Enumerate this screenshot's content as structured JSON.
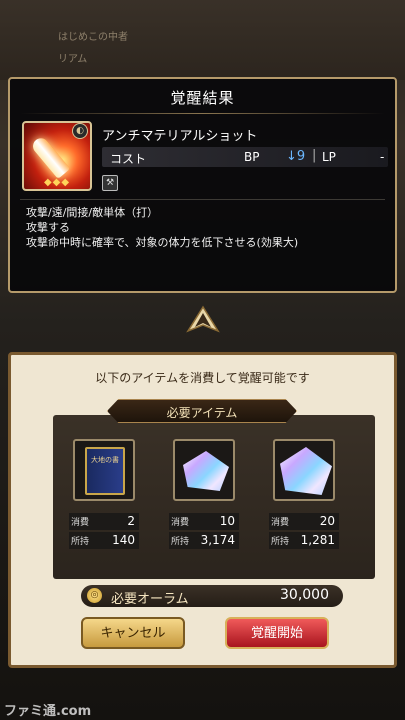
{
  "background": {
    "label1": "はじめこの中者",
    "label2": "リアム"
  },
  "result": {
    "title": "覚醒結果",
    "skill_name": "アンチマテリアルショット",
    "cost_label": "コスト",
    "bp_label": "BP",
    "bp_value": "↓9",
    "lp_label": "LP",
    "lp_value": "-",
    "stars": "◆◆◆",
    "description": [
      "攻撃/遠/間接/敵単体（打）",
      "攻撃する",
      "攻撃命中時に確率で、対象の体力を低下させる(効果大)"
    ]
  },
  "requirements": {
    "caption": "以下のアイテムを消費して覚醒可能です",
    "header": "必要アイテム",
    "consume_label": "消費",
    "owned_label": "所持",
    "items": [
      {
        "icon": "book-icon",
        "book_text": "大地の書",
        "consume": "2",
        "owned": "140"
      },
      {
        "icon": "crystal-icon",
        "consume": "10",
        "owned": "3,174"
      },
      {
        "icon": "large-crystal-icon",
        "consume": "20",
        "owned": "1,281"
      }
    ],
    "aurum_label": "必要オーラム",
    "aurum_value": "30,000",
    "cancel_label": "キャンセル",
    "start_label": "覚醒開始"
  },
  "watermark": "ファミ通.com",
  "colors": {
    "accent_blue": "#6bb7ff",
    "panel_gold": "#b59a6a",
    "start_red": "#c8202a"
  }
}
